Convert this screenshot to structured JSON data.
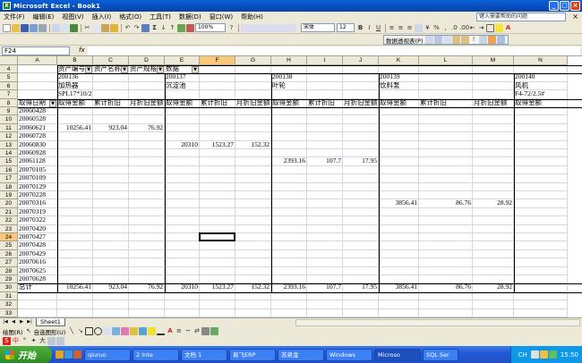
{
  "window": {
    "title": "Microsoft Excel - Book1",
    "app_icon": "excel-icon"
  },
  "menu": {
    "items": [
      "文件(F)",
      "编辑(E)",
      "视图(V)",
      "插入(I)",
      "格式(O)",
      "工具(T)",
      "数据(D)",
      "窗口(W)",
      "帮助(H)"
    ],
    "help_placeholder": "键入需要帮助的问题",
    "close_glyph": "×"
  },
  "toolbar": {
    "zoom": "100%",
    "font": "宋体",
    "size": "12",
    "pivot_label": "数据透视表(P)"
  },
  "formula_bar": {
    "name_box": "F24",
    "fx": "fx",
    "formula": ""
  },
  "sheet": {
    "columns": [
      "A",
      "B",
      "C",
      "D",
      "E",
      "F",
      "G",
      "H",
      "I",
      "J",
      "K",
      "L",
      "M",
      "N"
    ],
    "active_column": "F",
    "active_row": "24",
    "rows": [
      "4",
      "5",
      "6",
      "7",
      "8",
      "9",
      "10",
      "11",
      "12",
      "13",
      "14",
      "15",
      "16",
      "17",
      "18",
      "19",
      "20",
      "21",
      "22",
      "23",
      "24",
      "25",
      "26",
      "27",
      "28",
      "29",
      "30",
      "31",
      "32",
      "33"
    ],
    "pivot_page_fields": [
      "资产编号",
      "资产名称",
      "资产规格",
      "数据"
    ],
    "assets": [
      {
        "code": "200136",
        "name": "加热器",
        "spec": "SPL17*10/2"
      },
      {
        "code": "200137",
        "name": "沉淀池",
        "spec": ""
      },
      {
        "code": "200138",
        "name": "叶轮",
        "spec": ""
      },
      {
        "code": "200139",
        "name": "饮料泵",
        "spec": ""
      },
      {
        "code": "200140",
        "name": "风机",
        "spec": "F4-72/2.5#"
      }
    ],
    "row_field": "取得日期",
    "measures": [
      "取得金额",
      "累计折旧",
      "月折旧金额"
    ],
    "dates": [
      "20060428",
      "20060528",
      "20060621",
      "20060728",
      "20060830",
      "20060928",
      "20061128",
      "20070105",
      "20070109",
      "20070129",
      "20070228",
      "20070316",
      "20070319",
      "20070322",
      "20070420",
      "20070427",
      "20070428",
      "20070429",
      "20070616",
      "20070625",
      "20070628"
    ],
    "data_rows": {
      "20060621": {
        "B": "10256.41",
        "C": "923.04",
        "D": "76.92"
      },
      "20060830": {
        "E": "20310",
        "F": "1523.27",
        "G": "152.32"
      },
      "20061128": {
        "H": "2393.16",
        "I": "107.7",
        "J": "17.95"
      },
      "20070316": {
        "K": "3856.41",
        "L": "86.76",
        "M": "28.92"
      }
    },
    "total_label": "总计",
    "totals": {
      "B": "10256.41",
      "C": "923.04",
      "D": "76.92",
      "E": "20310",
      "F": "1523.27",
      "G": "152.32",
      "H": "2393.16",
      "I": "107.7",
      "J": "17.95",
      "K": "3856.41",
      "L": "86.76",
      "M": "28.92"
    },
    "sheet_tab": "Sheet1"
  },
  "drawing_bar": {
    "draw_label": "绘图(R)",
    "autoshape_label": "自选图形(U)"
  },
  "ime_bar": {
    "items": [
      "中",
      "大"
    ]
  },
  "taskbar": {
    "start_label": "开始",
    "tasks": [
      "qiuruo",
      "2 Inte",
      "文档 1",
      "易飞ERP",
      "苏泉金",
      "Windows",
      "Microso",
      "SQL Ser"
    ],
    "active_task": "Microso",
    "tray_lang": "CH",
    "clock": "15:50"
  }
}
